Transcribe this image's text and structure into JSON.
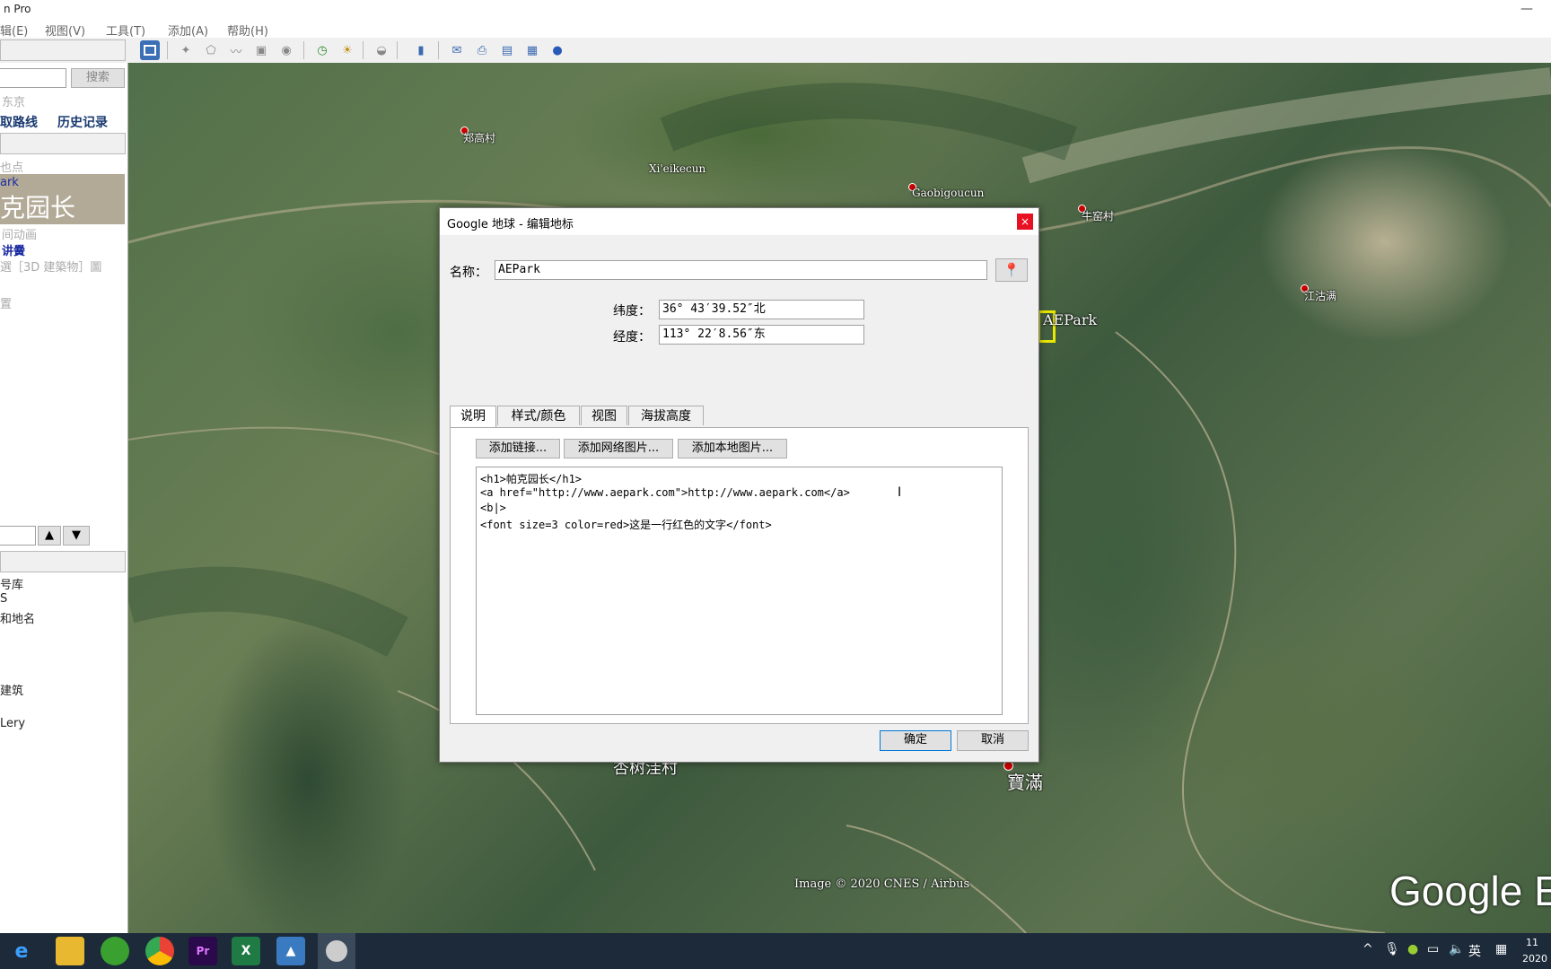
{
  "window": {
    "title_fragment": "n Pro"
  },
  "menu": [
    "辑(E)",
    "视图(V)",
    "工具(T)",
    "添加(A)",
    "帮助(H)"
  ],
  "left_panel": {
    "search_button": "搜索",
    "location_hint": "东京",
    "tab_route": "取路线",
    "tab_history": "历史记录",
    "places_header": "也点",
    "item_selected": "ark",
    "item_selected_big": "克园长",
    "item_tour": "间动画",
    "item_link": "讲黌",
    "item_hint": "選［3D 建築物］圖",
    "item_settings": "置",
    "layers": [
      "号库",
      "S",
      "和地名",
      "建筑",
      "Lery"
    ]
  },
  "map": {
    "labels": {
      "l1": "郑高村",
      "l2": "Xi'eikecun",
      "l3": "Gaobigoucun",
      "l4": "牛窑村",
      "l5": "江沽满",
      "l6": "AEPark",
      "l7": "杏树洼村",
      "l8": "寶滿"
    },
    "attribution": "Image © 2020 CNES / Airbus",
    "logo": "Google E"
  },
  "dialog": {
    "title": "Google 地球 - 编辑地标",
    "close": "×",
    "name_label": "名称：",
    "name_value": "AEPark",
    "lat_label": "纬度：",
    "lat_value": "36° 43′39.52″北",
    "lon_label": "经度：",
    "lon_value": "113° 22′8.56″东",
    "tabs": [
      "说明",
      "样式/颜色",
      "视图",
      "海拔高度"
    ],
    "active_tab": "说明",
    "add_link": "添加链接...",
    "add_web_image": "添加网络图片...",
    "add_local_image": "添加本地图片...",
    "code_lines": [
      "<h1>帕克园长</h1>",
      "<a href=\"http://www.aepark.com\">http://www.aepark.com</a>",
      "<b|>",
      "<font size=3 color=red>这是一行红色的文字</font>"
    ],
    "ok": "确定",
    "cancel": "取消"
  },
  "taskbar": {
    "ime": "英",
    "time": "11",
    "date": "2020"
  }
}
